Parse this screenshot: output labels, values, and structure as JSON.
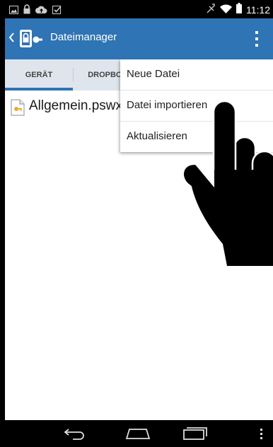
{
  "status_bar": {
    "time": "11:12",
    "left_icons": [
      "image-icon",
      "lock-icon",
      "cloud-upload-icon",
      "check-box-icon"
    ],
    "right_icons": [
      "signal-icon",
      "wifi-icon",
      "battery-icon"
    ]
  },
  "app_bar": {
    "title": "Dateimanager",
    "back_icon": "chevron-left-icon",
    "logo_icon": "app-logo-icon",
    "overflow_icon": "more-vert-icon",
    "color": "#2f74b4"
  },
  "tabs": [
    {
      "label": "GERÄT",
      "selected": true
    },
    {
      "label": "DROPBOX",
      "selected": false
    }
  ],
  "files": [
    {
      "name": "Allgemein.pswx",
      "icon": "key-file-icon"
    }
  ],
  "menu": {
    "items": [
      {
        "label": "Neue Datei"
      },
      {
        "label": "Datei importieren"
      },
      {
        "label": "Aktualisieren"
      }
    ]
  },
  "nav_bar": {
    "icons": [
      "back-icon",
      "home-icon",
      "recent-apps-icon",
      "menu-icon"
    ]
  }
}
